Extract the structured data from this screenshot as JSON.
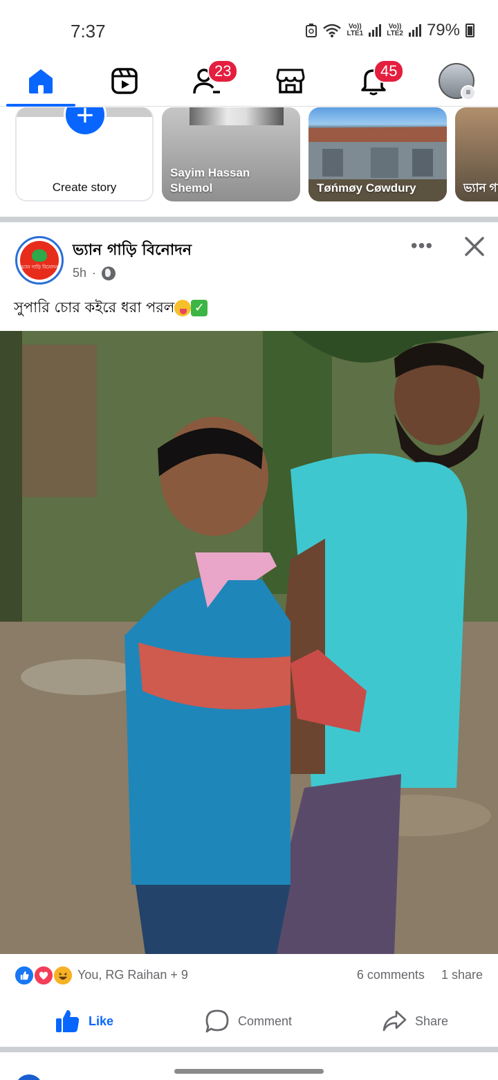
{
  "status_bar": {
    "time": "7:37",
    "lte1_label": "Vo))\nLTE1",
    "lte2_label": "Vo))\nLTE2",
    "battery_percent": "79%"
  },
  "nav": {
    "friends_badge": "23",
    "notifications_badge": "45",
    "active_tab": "home"
  },
  "stories": [
    {
      "label": "Create story"
    },
    {
      "name": "Sayim Hassan Shemol"
    },
    {
      "name": "Tøńmøy Cøwdury"
    },
    {
      "name": "ভ্যান গা"
    }
  ],
  "post": {
    "page_name": "ভ্যান গাড়ি বিনোদন",
    "time": "5h",
    "separator": "·",
    "more_label": "•••",
    "caption": "সুপারি চোর কইরে ধরা পরল",
    "avatar_text": "ভ্যান গাড়ি বিনোদন",
    "reactors": "You, RG Raihan + 9",
    "comments": "6 comments",
    "shares": "1 share"
  },
  "actions": {
    "like": "Like",
    "comment": "Comment",
    "share": "Share"
  },
  "colors": {
    "accent": "#0866ff",
    "badge": "#e41e3f",
    "secondary_text": "#65676b"
  }
}
